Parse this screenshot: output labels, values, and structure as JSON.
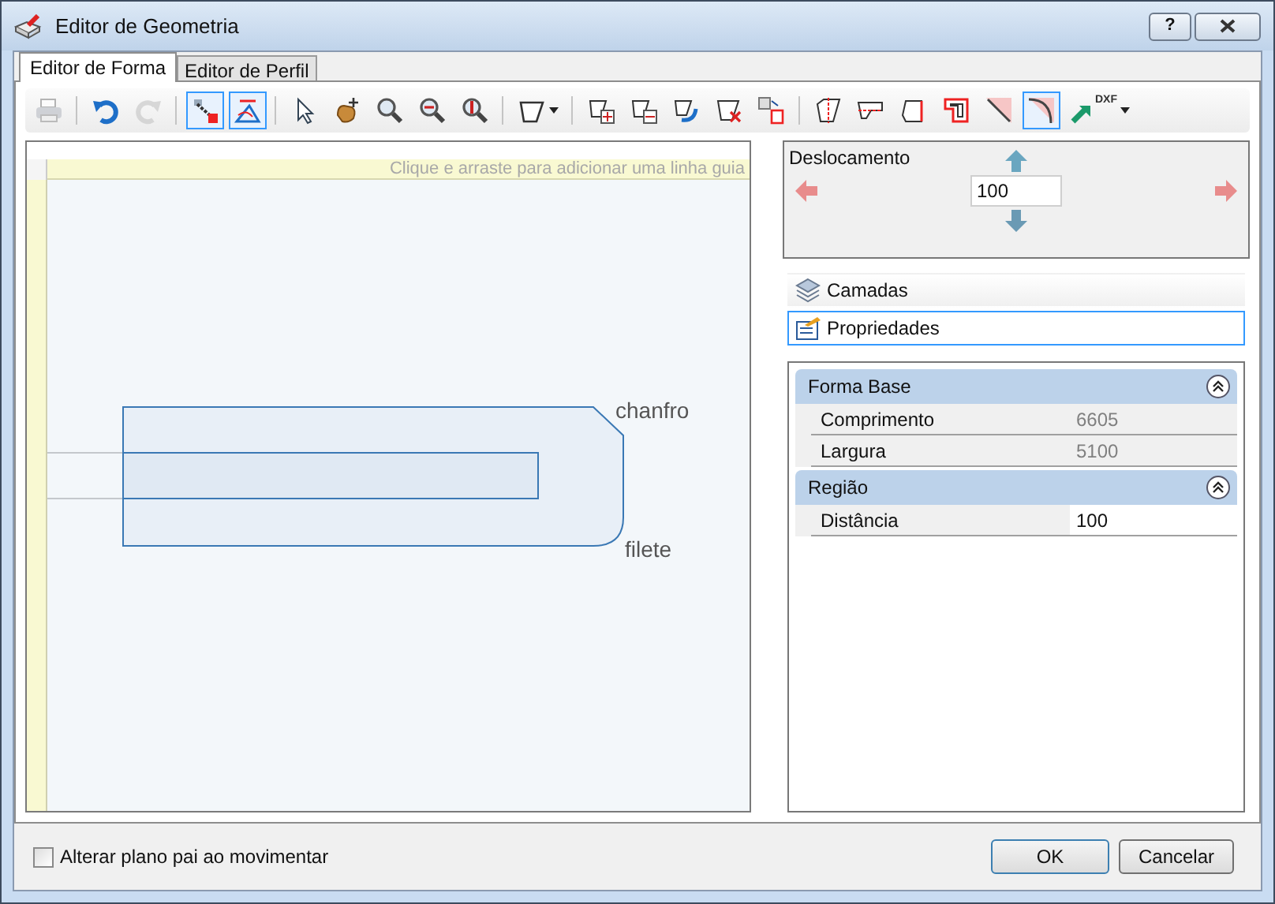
{
  "window": {
    "title": "Editor de Geometria",
    "help_button": "?"
  },
  "tabs": [
    {
      "label": "Editor de Forma",
      "selected": true
    },
    {
      "label": "Editor de Perfil",
      "selected": false
    }
  ],
  "toolbar": {
    "groups": [
      {
        "buttons": [
          {
            "selected": false,
            "disabled": true
          }
        ]
      },
      {
        "buttons": [
          {
            "selected": false,
            "disabled": false
          },
          {
            "selected": false,
            "disabled": true
          }
        ]
      },
      {
        "buttons": [
          {
            "selected": true,
            "disabled": false
          },
          {
            "selected": true,
            "disabled": false
          }
        ]
      },
      {
        "buttons": [
          {
            "selected": false,
            "disabled": false
          },
          {
            "selected": false,
            "disabled": false
          },
          {
            "selected": false,
            "disabled": false
          },
          {
            "selected": false,
            "disabled": false
          },
          {
            "selected": false,
            "disabled": false
          }
        ]
      },
      {
        "buttons": [
          {
            "selected": false,
            "disabled": false,
            "dropdown": true
          }
        ]
      },
      {
        "buttons": [
          {
            "selected": false,
            "disabled": false
          },
          {
            "selected": false,
            "disabled": false
          },
          {
            "selected": false,
            "disabled": false
          },
          {
            "selected": false,
            "disabled": false
          },
          {
            "selected": false,
            "disabled": false
          }
        ]
      },
      {
        "buttons": [
          {
            "selected": false,
            "disabled": false
          },
          {
            "selected": false,
            "disabled": false
          },
          {
            "selected": false,
            "disabled": false
          },
          {
            "selected": false,
            "disabled": false
          },
          {
            "selected": false,
            "disabled": false
          },
          {
            "selected": true,
            "disabled": false
          },
          {
            "selected": false,
            "disabled": false,
            "dropdown": true,
            "label": "DXF"
          }
        ]
      }
    ]
  },
  "canvas": {
    "guide_hint": "Clique e arraste para adicionar uma linha guia",
    "labels": [
      "chanfro",
      "filete"
    ]
  },
  "offset": {
    "title": "Deslocamento",
    "value": "100"
  },
  "panels": [
    {
      "label": "Camadas",
      "selected": false
    },
    {
      "label": "Propriedades",
      "selected": true
    }
  ],
  "properties": [
    {
      "category": "Forma Base",
      "expanded": true,
      "rows": [
        {
          "name": "Comprimento",
          "value": "6605",
          "editable": false
        },
        {
          "name": "Largura",
          "value": "5100",
          "editable": false
        }
      ]
    },
    {
      "category": "Região",
      "expanded": true,
      "rows": [
        {
          "name": "Distância",
          "value": "100",
          "editable": true
        }
      ]
    }
  ],
  "footer": {
    "checkbox": {
      "label": "Alterar plano pai ao movimentar",
      "checked": false
    },
    "buttons": [
      {
        "label": "OK",
        "default": true
      },
      {
        "label": "Cancelar",
        "default": false
      }
    ]
  }
}
